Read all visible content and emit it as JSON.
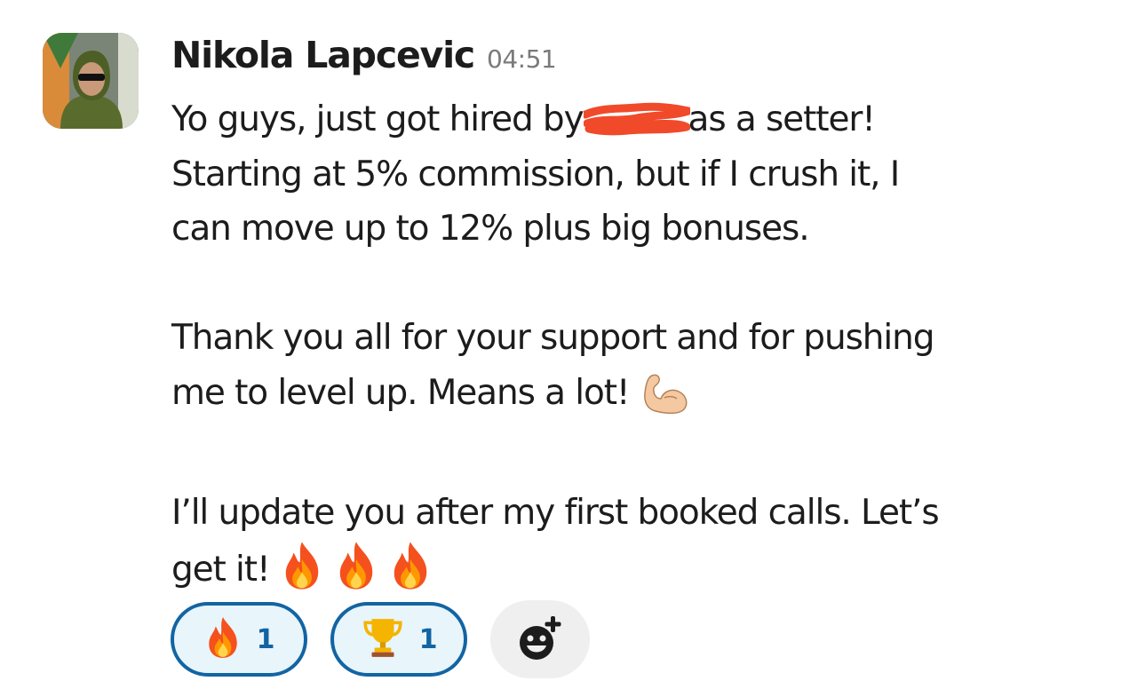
{
  "message": {
    "sender": "Nikola Lapcevic",
    "timestamp": "04:51",
    "lines": {
      "l1a": "Yo guys, just got hired by",
      "l1b": "as a setter!",
      "l2": "Starting at 5% commission, but if I crush it, I",
      "l3": "can move up to 12% plus big bonuses.",
      "l4": "Thank you all for your support and for pushing",
      "l5": "me to level up. Means a lot!",
      "l6": "I’ll update you after my first booked calls. Let’s",
      "l7": "get it!"
    },
    "inline_emojis": [
      "flexed-biceps",
      "fire",
      "fire",
      "fire"
    ]
  },
  "reactions": [
    {
      "emoji": "fire",
      "count": "1"
    },
    {
      "emoji": "trophy",
      "count": "1"
    }
  ],
  "colors": {
    "reaction_border": "#1264a3",
    "reaction_bg": "#e8f5fa",
    "timestamp": "#7a7a7a",
    "redaction": "#f04a2a"
  }
}
